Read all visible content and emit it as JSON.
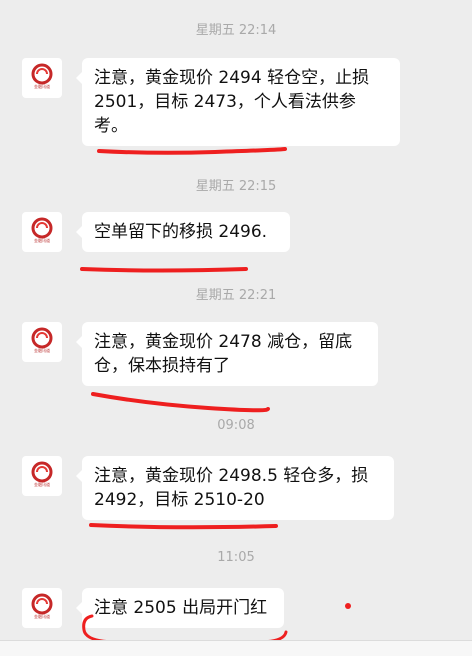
{
  "messages": [
    {
      "time": "星期五 22:14",
      "text": "注意，黄金现价 2494 轻仓空，止损 2501，目标 2473，个人看法供参考。"
    },
    {
      "time": "星期五 22:15",
      "text": "空单留下的移损 2496."
    },
    {
      "time": "星期五 22:21",
      "text": "注意，黄金现价 2478 减仓，留底仓，保本损持有了"
    },
    {
      "time": "09:08",
      "text": "注意，黄金现价 2498.5 轻仓多，损 2492，目标 2510-20"
    },
    {
      "time": "11:05",
      "text": "注意 2505 出局开门红"
    }
  ],
  "avatar": {
    "brand_text": "金融讯道",
    "icon": "brand-logo-icon"
  },
  "colors": {
    "annotation": "#ee1f1f",
    "bubble": "#ffffff",
    "background": "#ededed"
  }
}
